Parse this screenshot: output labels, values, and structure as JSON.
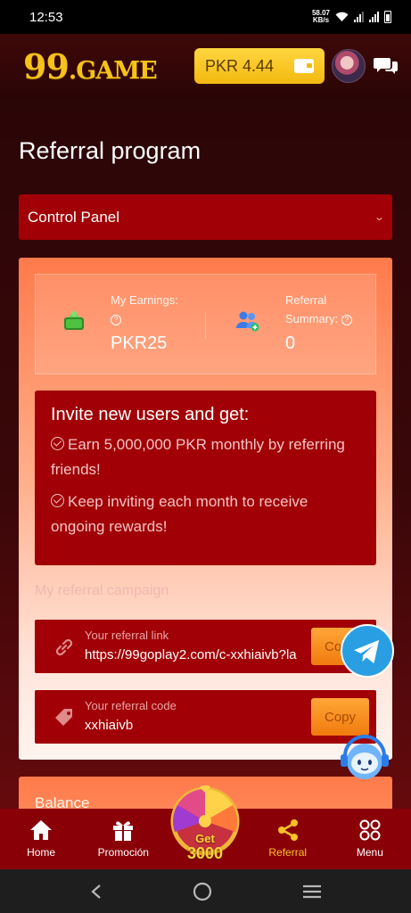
{
  "status_bar": {
    "time": "12:53",
    "net_speed_value": "58.07",
    "net_speed_unit": "KB/s"
  },
  "header": {
    "logo_big": "99",
    "logo_text": ".GAME",
    "wallet_balance": "PKR 4.44"
  },
  "page": {
    "title": "Referral program",
    "control_panel_label": "Control Panel"
  },
  "earnings": {
    "my_earnings_label": "My Earnings:",
    "my_earnings_value": "PKR25",
    "referral_summary_label_1": "Referral",
    "referral_summary_label_2": "Summary:",
    "referral_summary_value": "0"
  },
  "invite": {
    "title": "Invite new users and get:",
    "items": [
      "Earn 5,000,000 PKR monthly by referring friends!",
      "Keep inviting each month to receive ongoing rewards!"
    ]
  },
  "campaign": {
    "title": "My referral campaign",
    "link_label": "Your referral link",
    "link_value": "https://99goplay2.com/c-xxhiaivb?la",
    "link_copy": "Copy",
    "code_label": "Your referral code",
    "code_value": "xxhiaivb",
    "code_copy": "Copy"
  },
  "balance": {
    "label": "Balance"
  },
  "wheel": {
    "line1": "Get",
    "line2": "3000"
  },
  "bottom_nav": {
    "items": [
      {
        "label": "Home",
        "icon": "home-icon"
      },
      {
        "label": "Promoción",
        "icon": "gift-icon"
      },
      {
        "label": "Referral",
        "icon": "share-icon",
        "active": true
      },
      {
        "label": "Menu",
        "icon": "grid-icon"
      }
    ]
  },
  "colors": {
    "accent_red": "#a10006",
    "gold": "#f7c127",
    "nav_bg": "#8a0007",
    "copy_orange": "#f17a0e"
  }
}
